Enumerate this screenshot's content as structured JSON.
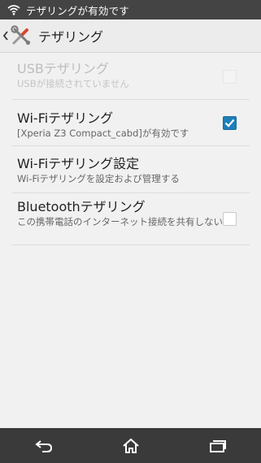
{
  "status_bar": {
    "text": "テザリングが有効です",
    "icon": "wifi-icon"
  },
  "action_bar": {
    "back_icon": "chevron-left-icon",
    "app_icon": "settings-tools-icon",
    "title": "テザリング"
  },
  "items": [
    {
      "title": "USBテザリング",
      "summary": "USBが接続されていません",
      "checkbox": "disabled",
      "enabled": false
    },
    {
      "title": "Wi-Fiテザリング",
      "summary": "[Xperia Z3 Compact_cabd]が有効です",
      "checkbox": "checked",
      "enabled": true
    },
    {
      "title": "Wi-Fiテザリング設定",
      "summary": "Wi-Fiテザリングを設定および管理する",
      "checkbox": "none",
      "enabled": true
    },
    {
      "title": "Bluetoothテザリング",
      "summary": "この携帯電話のインターネット接続を共有しない",
      "checkbox": "unchecked",
      "enabled": true
    }
  ],
  "nav_bar": {
    "back": "back-icon",
    "home": "home-icon",
    "recents": "recents-icon"
  },
  "colors": {
    "accent": "#1f7fb9",
    "status_bar": "#444444",
    "nav_bar": "#3a3a3a",
    "background": "#f1f1f1"
  }
}
